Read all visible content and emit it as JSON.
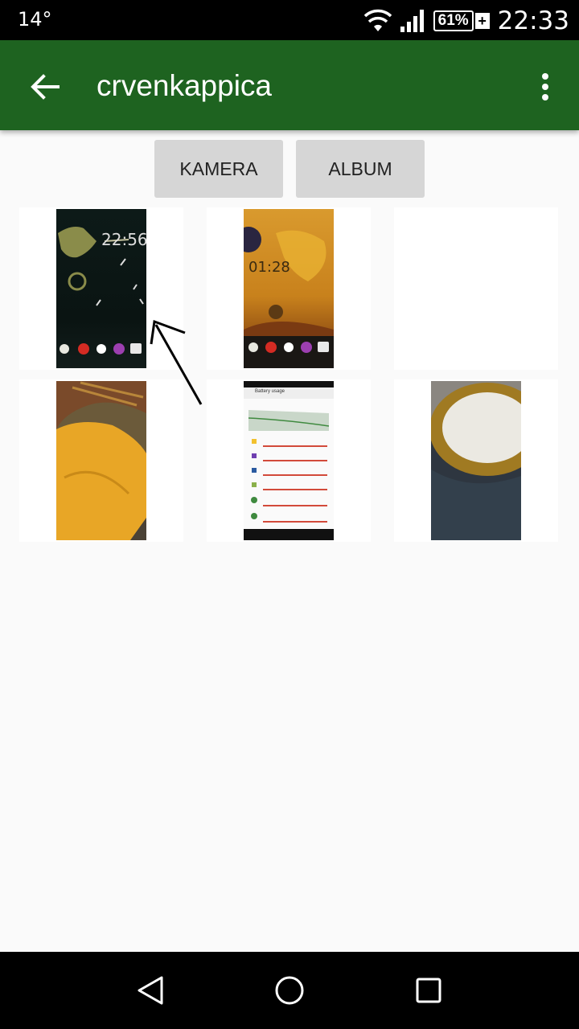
{
  "status_bar": {
    "temperature": "14°",
    "battery_percent": "61%",
    "battery_charging_symbol": "+",
    "time": "22:33",
    "icons": [
      "wifi-icon",
      "signal-icon",
      "battery-icon"
    ]
  },
  "app_bar": {
    "title": "crvenkappica",
    "back_icon": "arrow-back-icon",
    "menu_icon": "more-vert-icon"
  },
  "actions": {
    "camera_label": "KAMERA",
    "album_label": "ALBUM"
  },
  "thumbnails": [
    {
      "kind": "lockscreen",
      "clock": "22:56"
    },
    {
      "kind": "lockscreen",
      "clock": "01:28"
    },
    {
      "kind": "blank"
    },
    {
      "kind": "photo-fabric"
    },
    {
      "kind": "battery-usage",
      "header": "Battery usage"
    },
    {
      "kind": "photo-plate"
    }
  ],
  "nav_bar": {
    "icons": [
      "back-triangle-icon",
      "home-circle-icon",
      "recents-square-icon"
    ]
  },
  "colors": {
    "app_bar": "#1e6320",
    "status_bar": "#000000",
    "background": "#fafafa",
    "button": "#d6d6d6"
  }
}
